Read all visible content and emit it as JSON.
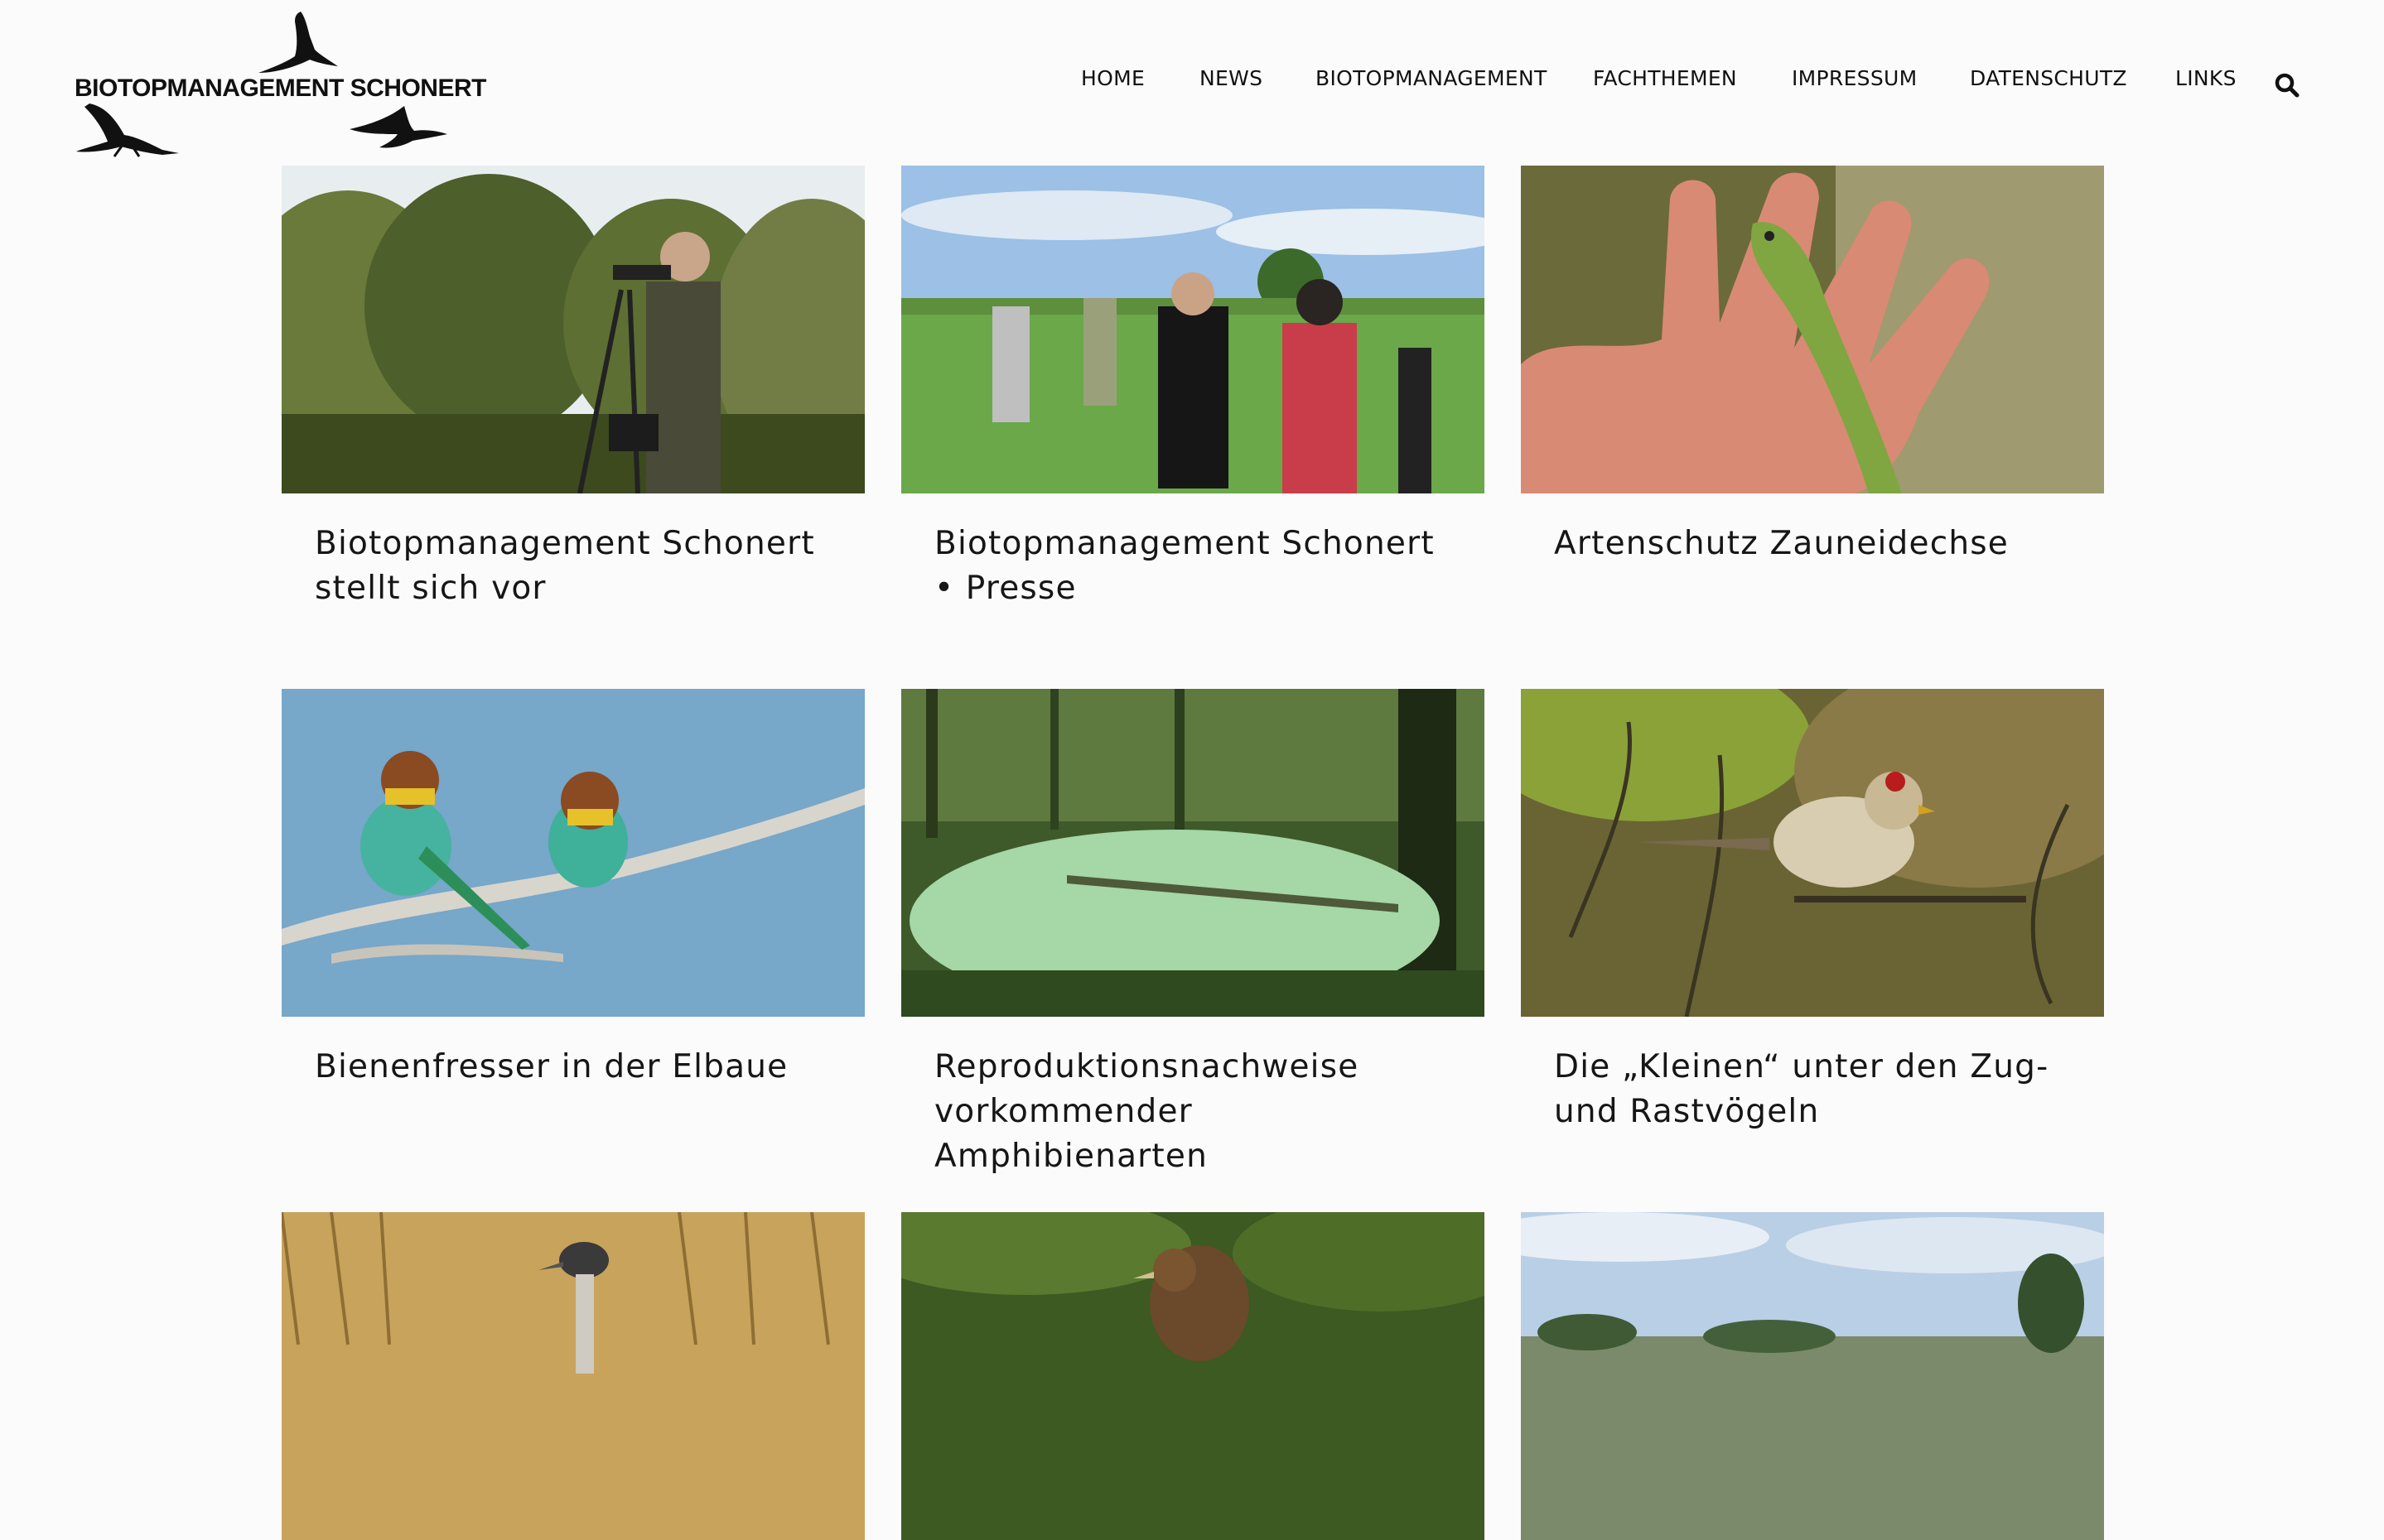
{
  "site": {
    "logo_text": "BIOTOPMANAGEMENT SCHONERT"
  },
  "nav": {
    "items": [
      {
        "label": "HOME"
      },
      {
        "label": "NEWS"
      },
      {
        "label": "BIOTOPMANAGEMENT"
      },
      {
        "label": "FACHTHEMEN"
      },
      {
        "label": "IMPRESSUM"
      },
      {
        "label": "DATENSCHUTZ"
      },
      {
        "label": "LINKS"
      }
    ],
    "search_icon": "search-icon"
  },
  "posts": [
    {
      "title": "Biotopmanagement Schonert stellt sich vor"
    },
    {
      "title": "Biotopmanagement Schonert • Presse"
    },
    {
      "title": "Artenschutz Zauneidechse"
    },
    {
      "title": "Bienenfresser in der Elbaue"
    },
    {
      "title": "Reproduktionsnachweise vorkommender Amphibienarten"
    },
    {
      "title": "Die „Kleinen“ unter den Zug- und Rastvögeln"
    },
    {
      "title": ""
    },
    {
      "title": ""
    },
    {
      "title": ""
    }
  ]
}
